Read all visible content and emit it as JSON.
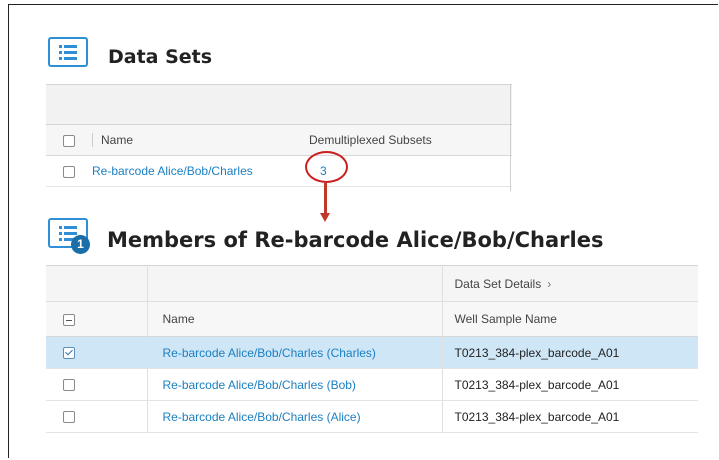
{
  "data_sets": {
    "title": "Data Sets",
    "columns": {
      "name": "Name",
      "subsets": "Demultiplexed Subsets"
    },
    "rows": [
      {
        "name": "Re-barcode Alice/Bob/Charles",
        "subsets": "3",
        "checked": false
      }
    ]
  },
  "members": {
    "badge": "1",
    "title": "Members of Re-barcode Alice/Bob/Charles",
    "group_header": "Data Set Details",
    "columns": {
      "name": "Name",
      "well": "Well Sample Name"
    },
    "rows": [
      {
        "name": "Re-barcode Alice/Bob/Charles (Charles)",
        "well": "T0213_384-plex_barcode_A01",
        "checked": true
      },
      {
        "name": "Re-barcode Alice/Bob/Charles (Bob)",
        "well": "T0213_384-plex_barcode_A01",
        "checked": false
      },
      {
        "name": "Re-barcode Alice/Bob/Charles (Alice)",
        "well": "T0213_384-plex_barcode_A01",
        "checked": false
      }
    ]
  },
  "colors": {
    "link": "#1a7fc1",
    "selected_row": "#cfe6f7",
    "icon_blue": "#2f8fd6",
    "annotation_red": "#c8201e"
  },
  "icons": {
    "section": "list-icon",
    "group_chevron": "chevron-right-icon"
  }
}
